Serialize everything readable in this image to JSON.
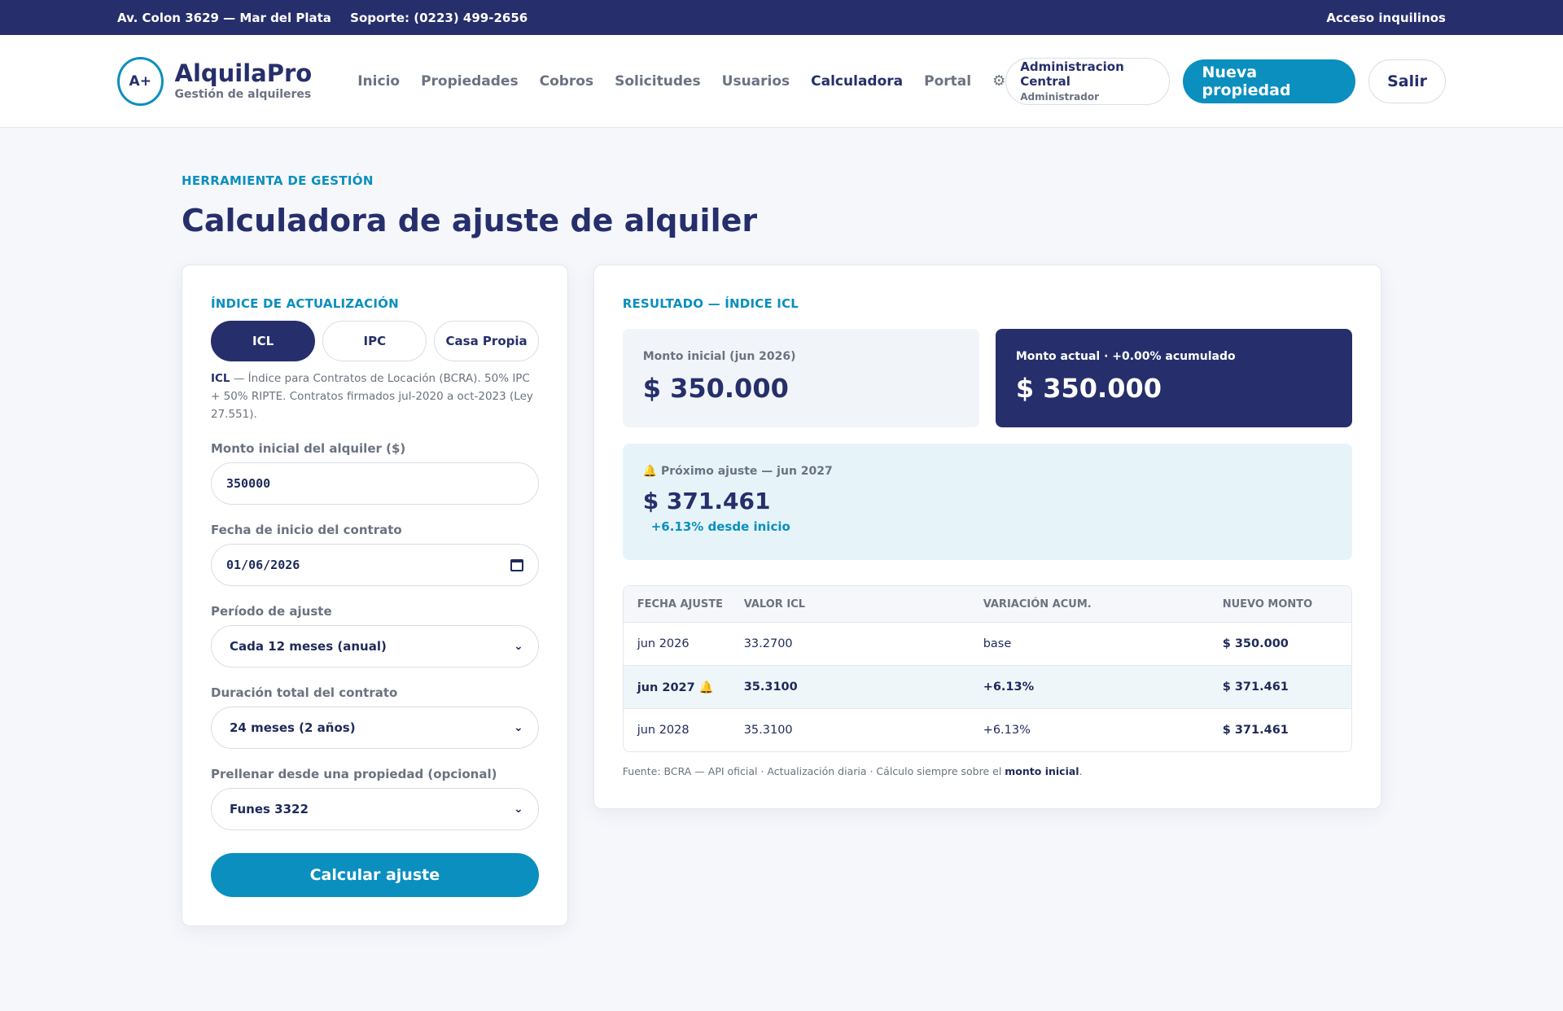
{
  "topbar": {
    "address": "Av. Colon 3629 — Mar del Plata",
    "support": "Soporte: (0223) 499-2656",
    "tenant_access": "Acceso inquilinos"
  },
  "header": {
    "logo_text": "A+",
    "brand_name": "AlquilaPro",
    "brand_sub": "Gestión de alquileres",
    "nav": [
      "Inicio",
      "Propiedades",
      "Cobros",
      "Solicitudes",
      "Usuarios",
      "Calculadora",
      "Portal"
    ],
    "gear_icon": "⚙",
    "user_name": "Administracion Central",
    "user_role": "Administrador",
    "new_property": "Nueva propiedad",
    "logout": "Salir"
  },
  "page": {
    "eyebrow": "HERRAMIENTA DE GESTIÓN",
    "title": "Calculadora de ajuste de alquiler"
  },
  "form": {
    "index_label": "ÍNDICE DE ACTUALIZACIÓN",
    "index_options": [
      "ICL",
      "IPC",
      "Casa Propia"
    ],
    "index_selected": "ICL",
    "desc_strong": "ICL",
    "desc_text": " — Índice para Contratos de Locación (BCRA). 50% IPC + 50% RIPTE. Contratos firmados jul-2020 a oct-2023 (Ley 27.551).",
    "amount_label": "Monto inicial del alquiler ($)",
    "amount_value": "350000",
    "date_label": "Fecha de inicio del contrato",
    "date_value": "01/06/2026",
    "period_label": "Período de ajuste",
    "period_value": "Cada 12 meses (anual)",
    "duration_label": "Duración total del contrato",
    "duration_value": "24 meses (2 años)",
    "prefill_label": "Prellenar desde una propiedad (opcional)",
    "prefill_value": "Funes 3322",
    "submit": "Calcular ajuste"
  },
  "result": {
    "label": "RESULTADO — ÍNDICE ICL",
    "initial_label": "Monto inicial (jun 2026)",
    "initial_value": "$ 350.000",
    "current_label": "Monto actual · +0.00% acumulado",
    "current_value": "$ 350.000",
    "next_label": "Próximo ajuste — jun 2027",
    "next_value": "$ 371.461",
    "next_delta": "+6.13% desde inicio",
    "table_headers": [
      "FECHA AJUSTE",
      "VALOR ICL",
      "VARIACIÓN ACUM.",
      "NUEVO MONTO"
    ],
    "rows": [
      {
        "date": "jun 2026",
        "icl": "33.2700",
        "var": "base",
        "amount": "$ 350.000"
      },
      {
        "date": "jun 2027",
        "icl": "35.3100",
        "var": "+6.13%",
        "amount": "$ 371.461"
      },
      {
        "date": "jun 2028",
        "icl": "35.3100",
        "var": "+6.13%",
        "amount": "$ 371.461"
      }
    ],
    "footer_text": "Fuente: BCRA — API oficial · Actualización diaria · Cálculo siempre sobre el ",
    "footer_strong": "monto inicial",
    "footer_end": "."
  },
  "colors": {
    "navy": "#262f6b",
    "accent": "#0a8fbf",
    "bell": "#f0b429"
  }
}
